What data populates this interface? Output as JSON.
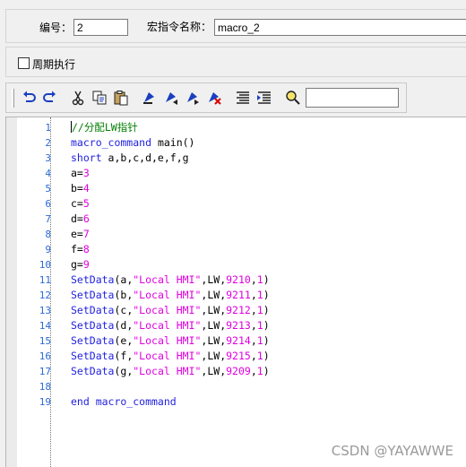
{
  "form": {
    "id_label": "编号：",
    "id_value": "2",
    "name_label": "宏指令名称：",
    "name_value": "macro_2",
    "periodic_label": "周期执行",
    "periodic_checked": false
  },
  "toolbar": {
    "buttons": [
      {
        "name": "undo-icon"
      },
      {
        "name": "redo-icon"
      },
      {
        "name": "cut-icon"
      },
      {
        "name": "copy-icon"
      },
      {
        "name": "paste-icon"
      },
      {
        "name": "toggle-bookmark-icon"
      },
      {
        "name": "prev-bookmark-icon"
      },
      {
        "name": "next-bookmark-icon"
      },
      {
        "name": "clear-bookmarks-icon"
      },
      {
        "name": "align-icon"
      },
      {
        "name": "indent-icon"
      },
      {
        "name": "find-icon"
      }
    ],
    "search_value": ""
  },
  "editor": {
    "lines": [
      {
        "n": "1",
        "tokens": [
          [
            "com",
            "//分配LW指针"
          ]
        ]
      },
      {
        "n": "2",
        "tokens": [
          [
            "kw",
            "macro_command"
          ],
          [
            "id",
            " main()"
          ]
        ]
      },
      {
        "n": "3",
        "tokens": [
          [
            "kw",
            "short"
          ],
          [
            "id",
            " a,b,c,d,e,f,g"
          ]
        ]
      },
      {
        "n": "4",
        "tokens": [
          [
            "id",
            "a="
          ],
          [
            "num",
            "3"
          ]
        ]
      },
      {
        "n": "5",
        "tokens": [
          [
            "id",
            "b="
          ],
          [
            "num",
            "4"
          ]
        ]
      },
      {
        "n": "6",
        "tokens": [
          [
            "id",
            "c="
          ],
          [
            "num",
            "5"
          ]
        ]
      },
      {
        "n": "7",
        "tokens": [
          [
            "id",
            "d="
          ],
          [
            "num",
            "6"
          ]
        ]
      },
      {
        "n": "8",
        "tokens": [
          [
            "id",
            "e="
          ],
          [
            "num",
            "7"
          ]
        ]
      },
      {
        "n": "9",
        "tokens": [
          [
            "id",
            "f="
          ],
          [
            "num",
            "8"
          ]
        ]
      },
      {
        "n": "10",
        "tokens": [
          [
            "id",
            "g="
          ],
          [
            "num",
            "9"
          ]
        ]
      },
      {
        "n": "11",
        "tokens": [
          [
            "fn",
            "SetData"
          ],
          [
            "id",
            "(a,"
          ],
          [
            "str",
            "\"Local HMI\""
          ],
          [
            "id",
            ",LW,"
          ],
          [
            "num",
            "9210"
          ],
          [
            "id",
            ","
          ],
          [
            "num",
            "1"
          ],
          [
            "id",
            ")"
          ]
        ]
      },
      {
        "n": "12",
        "tokens": [
          [
            "fn",
            "SetData"
          ],
          [
            "id",
            "(b,"
          ],
          [
            "str",
            "\"Local HMI\""
          ],
          [
            "id",
            ",LW,"
          ],
          [
            "num",
            "9211"
          ],
          [
            "id",
            ","
          ],
          [
            "num",
            "1"
          ],
          [
            "id",
            ")"
          ]
        ]
      },
      {
        "n": "13",
        "tokens": [
          [
            "fn",
            "SetData"
          ],
          [
            "id",
            "(c,"
          ],
          [
            "str",
            "\"Local HMI\""
          ],
          [
            "id",
            ",LW,"
          ],
          [
            "num",
            "9212"
          ],
          [
            "id",
            ","
          ],
          [
            "num",
            "1"
          ],
          [
            "id",
            ")"
          ]
        ]
      },
      {
        "n": "14",
        "tokens": [
          [
            "fn",
            "SetData"
          ],
          [
            "id",
            "(d,"
          ],
          [
            "str",
            "\"Local HMI\""
          ],
          [
            "id",
            ",LW,"
          ],
          [
            "num",
            "9213"
          ],
          [
            "id",
            ","
          ],
          [
            "num",
            "1"
          ],
          [
            "id",
            ")"
          ]
        ]
      },
      {
        "n": "15",
        "tokens": [
          [
            "fn",
            "SetData"
          ],
          [
            "id",
            "(e,"
          ],
          [
            "str",
            "\"Local HMI\""
          ],
          [
            "id",
            ",LW,"
          ],
          [
            "num",
            "9214"
          ],
          [
            "id",
            ","
          ],
          [
            "num",
            "1"
          ],
          [
            "id",
            ")"
          ]
        ]
      },
      {
        "n": "16",
        "tokens": [
          [
            "fn",
            "SetData"
          ],
          [
            "id",
            "(f,"
          ],
          [
            "str",
            "\"Local HMI\""
          ],
          [
            "id",
            ",LW,"
          ],
          [
            "num",
            "9215"
          ],
          [
            "id",
            ","
          ],
          [
            "num",
            "1"
          ],
          [
            "id",
            ")"
          ]
        ]
      },
      {
        "n": "17",
        "tokens": [
          [
            "fn",
            "SetData"
          ],
          [
            "id",
            "(g,"
          ],
          [
            "str",
            "\"Local HMI\""
          ],
          [
            "id",
            ",LW,"
          ],
          [
            "num",
            "9209"
          ],
          [
            "id",
            ","
          ],
          [
            "num",
            "1"
          ],
          [
            "id",
            ")"
          ]
        ]
      },
      {
        "n": "18",
        "tokens": []
      },
      {
        "n": "19",
        "tokens": [
          [
            "kw",
            "end macro_command"
          ]
        ]
      }
    ]
  },
  "watermark": "CSDN @YAYAWWE",
  "colors": {
    "keyword": "#1f1fe0",
    "comment": "#008000",
    "number": "#e000e0",
    "string": "#e000e0",
    "line_number": "#2b6ad6"
  }
}
